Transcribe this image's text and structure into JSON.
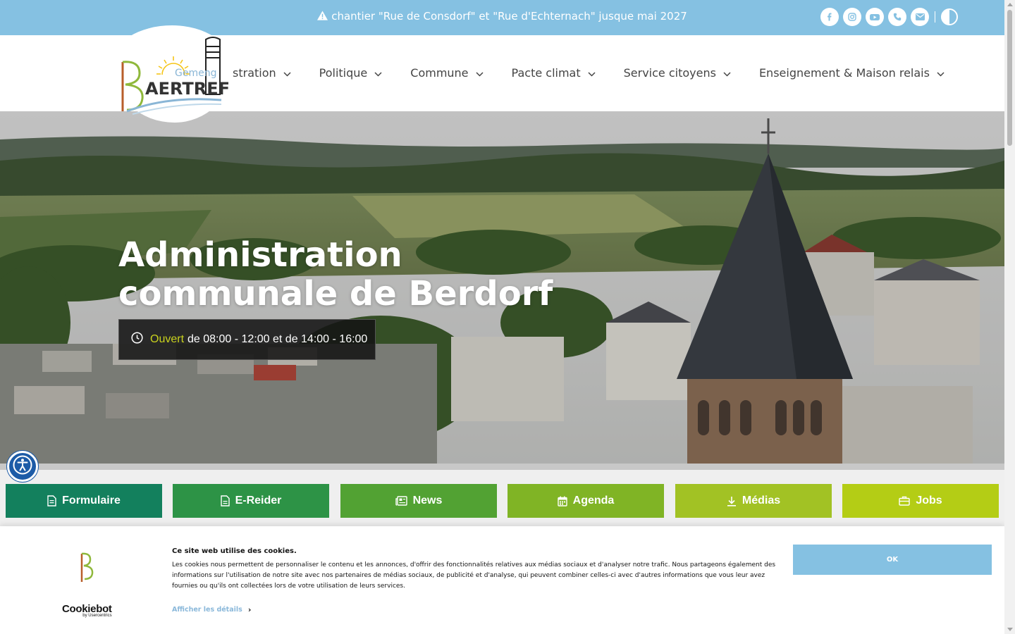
{
  "topbar": {
    "notice": "chantier \"Rue de Consdorf\" et \"Rue d'Echternach\" jusque mai 2027",
    "socials": [
      "facebook-icon",
      "instagram-icon",
      "youtube-icon",
      "phone-icon",
      "email-icon"
    ],
    "color": "#85c1e2"
  },
  "logo": {
    "line1": "Gemeng",
    "line2": "AERTREF",
    "initial": "B"
  },
  "nav": {
    "items": [
      {
        "label": "stration"
      },
      {
        "label": "Politique"
      },
      {
        "label": "Commune"
      },
      {
        "label": "Pacte climat"
      },
      {
        "label": "Service citoyens"
      },
      {
        "label": "Enseignement & Maison relais"
      }
    ]
  },
  "hero": {
    "title_line1": "Administration",
    "title_line2": "communale de Berdorf",
    "status": "Ouvert",
    "hours": "de 08:00 - 12:00 et de 14:00 - 16:00"
  },
  "quick_links": [
    {
      "label": "Formulaire",
      "icon": "form-icon",
      "color": "#13805d"
    },
    {
      "label": "E-Reider",
      "icon": "document-icon",
      "color": "#2d9346"
    },
    {
      "label": "News",
      "icon": "newspaper-icon",
      "color": "#52a233"
    },
    {
      "label": "Agenda",
      "icon": "calendar-icon",
      "color": "#80b425"
    },
    {
      "label": "Médias",
      "icon": "download-icon",
      "color": "#a2c224"
    },
    {
      "label": "Jobs",
      "icon": "briefcase-icon",
      "color": "#b4cd15"
    }
  ],
  "cookie": {
    "title": "Ce site web utilise des cookies.",
    "text": "Les cookies nous permettent de personnaliser le contenu et les annonces, d'offrir des fonctionnalités relatives aux médias sociaux et d'analyser notre trafic. Nous partageons également des informations sur l'utilisation de notre site avec nos partenaires de médias sociaux, de publicité et d'analyse, qui peuvent combiner celles-ci avec d'autres informations que vous leur avez fournies ou qu'ils ont collectées lors de votre utilisation de leurs services.",
    "details": "Afficher les détails",
    "ok": "OK",
    "brand": "Cookiebot",
    "brand_sub": "by Usercentrics"
  }
}
